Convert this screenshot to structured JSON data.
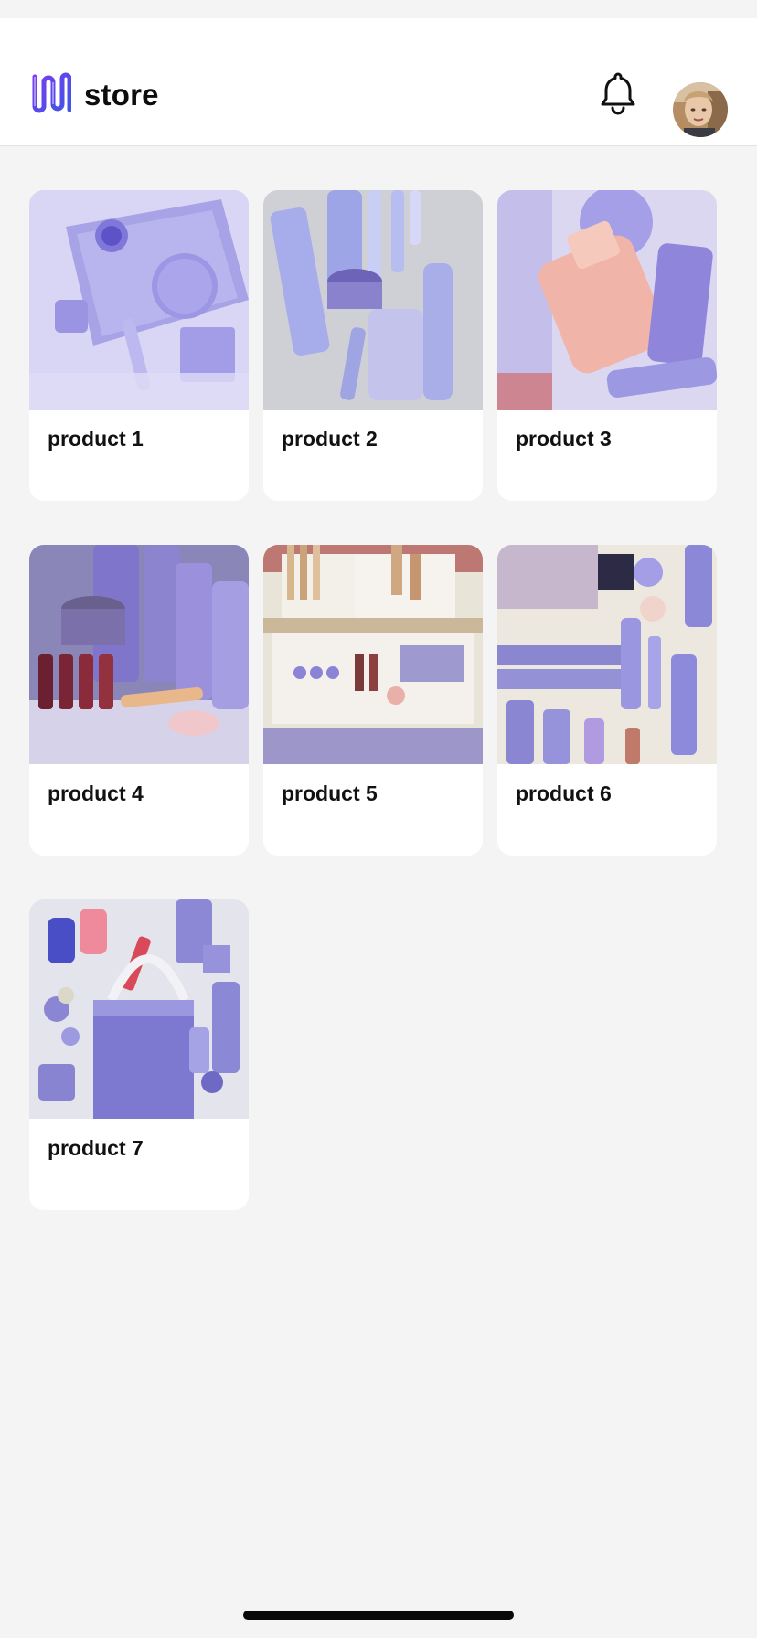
{
  "app": {
    "title": "store"
  },
  "header": {
    "logo_icon": "brand-logo-icon",
    "notification_icon": "bell-icon",
    "avatar": "user-avatar"
  },
  "products": [
    {
      "name": "product 1",
      "theme": "#a9a6e6"
    },
    {
      "name": "product 2",
      "theme": "#9fa5df"
    },
    {
      "name": "product 3",
      "theme": "#b4aee6"
    },
    {
      "name": "product 4",
      "theme": "#8f86c9"
    },
    {
      "name": "product 5",
      "theme": "#b9a98e"
    },
    {
      "name": "product 6",
      "theme": "#9c9dd8"
    },
    {
      "name": "product 7",
      "theme": "#a7a9e0"
    }
  ],
  "colors": {
    "accent": "#6d5ce8",
    "background": "#f4f4f5",
    "card": "#ffffff",
    "text": "#111113"
  }
}
